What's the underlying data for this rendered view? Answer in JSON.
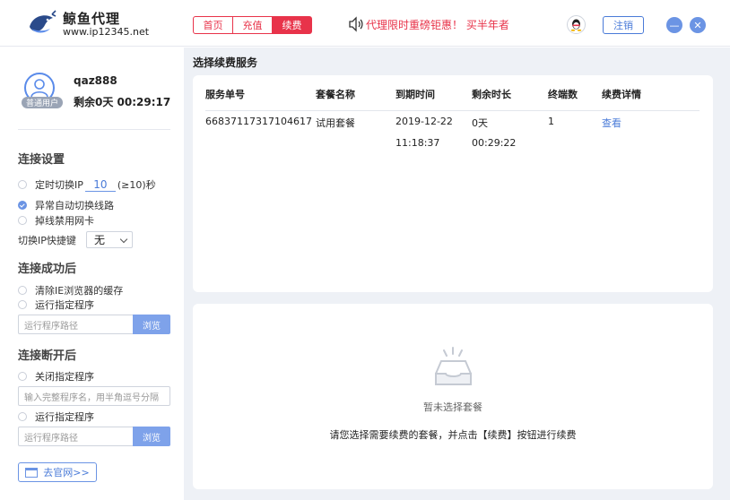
{
  "header": {
    "brand_name": "鲸鱼代理",
    "brand_url": "www.ip12345.net",
    "nav": [
      "首页",
      "充值",
      "续费"
    ],
    "active_nav": 2,
    "marquee": "代理限时重磅钜惠！ 买半年者",
    "logout_label": "注销",
    "minimize_glyph": "—",
    "close_glyph": "✕"
  },
  "user": {
    "badge": "普通用户",
    "username": "qaz888",
    "remaining": "剩余0天 00:29:17"
  },
  "connect_settings": {
    "title": "连接设置",
    "timed_switch_prefix": "定时切换IP",
    "timed_switch_value": "10",
    "timed_switch_suffix": "(≥10)秒",
    "auto_switch_label": "异常自动切换线路",
    "disconnect_nic_label": "掉线禁用网卡",
    "hotkey_label": "切换IP快捷键",
    "hotkey_value": "无"
  },
  "on_connect": {
    "title": "连接成功后",
    "clear_cache_label": "清除IE浏览器的缓存",
    "run_program_label": "运行指定程序",
    "path_placeholder": "运行程序路径",
    "browse_label": "浏览"
  },
  "on_disconnect": {
    "title": "连接断开后",
    "close_program_label": "关闭指定程序",
    "program_names_placeholder": "输入完整程序名，用半角逗号分隔",
    "run_program_label": "运行指定程序",
    "path_placeholder": "运行程序路径",
    "browse_label": "浏览"
  },
  "website_button": "去官网>>",
  "renew": {
    "title": "选择续费服务",
    "columns": [
      "服务单号",
      "套餐名称",
      "到期时间",
      "剩余时长",
      "终端数",
      "续费详情"
    ],
    "row": {
      "order_id": "66837117317104617",
      "plan": "试用套餐",
      "expire_date": "2019-12-22",
      "expire_time": "11:18:37",
      "remain_days": "0天",
      "remain_time": "00:29:22",
      "terminals": "1",
      "detail_link": "查看"
    },
    "empty_text": "暂未选择套餐",
    "empty_hint": "请您选择需要续费的套餐，并点击【续费】按钮进行续费"
  },
  "colors": {
    "accent_red": "#e8334a",
    "accent_blue": "#4a7bd8",
    "button_blue": "#7ea2ea"
  }
}
